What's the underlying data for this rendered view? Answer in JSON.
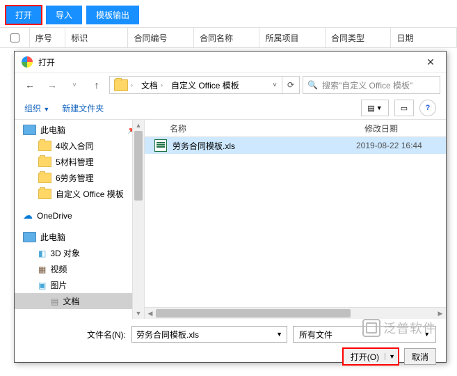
{
  "toolbar": {
    "open": "打开",
    "import": "导入",
    "template": "模板输出"
  },
  "table": {
    "seq": "序号",
    "mark": "标识",
    "contract_no": "合同编号",
    "contract_name": "合同名称",
    "project": "所属项目",
    "type": "合同类型",
    "date": "日期"
  },
  "dialog": {
    "title": "打开",
    "close": "✕",
    "breadcrumb": {
      "docs": "文档",
      "custom": "自定义 Office 模板"
    },
    "search_placeholder": "搜索\"自定义 Office 模板\"",
    "organize": "组织",
    "newfolder": "新建文件夹",
    "list": {
      "col_name": "名称",
      "col_date": "修改日期",
      "file_name": "劳务合同模板.xls",
      "file_date": "2019-08-22 16:44"
    },
    "tree": {
      "thispc": "此电脑",
      "f1": "4收入合同",
      "f2": "5材料管理",
      "f3": "6劳务管理",
      "f4": "自定义 Office 模板",
      "onedrive": "OneDrive",
      "thispc2": "此电脑",
      "obj3d": "3D 对象",
      "video": "视频",
      "pic": "图片",
      "docs": "文档"
    },
    "filename_label": "文件名(N):",
    "filename_value": "劳务合同模板.xls",
    "filter": "所有文件",
    "open_btn": "打开(O)",
    "cancel_btn": "取消"
  },
  "watermark": "泛普软件"
}
